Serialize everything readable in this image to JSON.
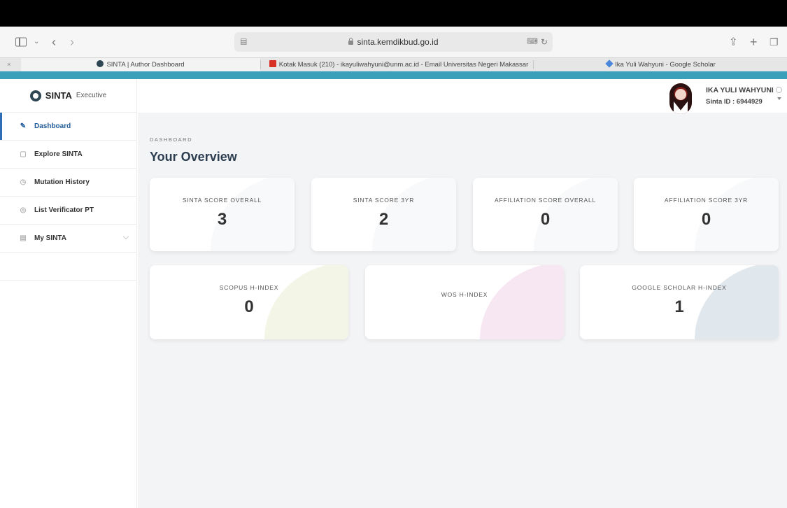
{
  "browser": {
    "url": "sinta.kemdikbud.go.id",
    "tabs": [
      {
        "label": "SINTA | Author Dashboard",
        "active": true
      },
      {
        "label": "Kotak Masuk (210) - ikayuliwahyuni@unm.ac.id - Email Universitas Negeri Makassar",
        "active": false
      },
      {
        "label": "Ika Yuli Wahyuni - Google Scholar",
        "active": false
      }
    ]
  },
  "app": {
    "brand": {
      "strong": "SINTA",
      "light": "Executive"
    }
  },
  "sidebar": {
    "items": [
      {
        "label": "Dashboard",
        "icon": "pencil-icon",
        "active": true
      },
      {
        "label": "Explore SINTA",
        "icon": "search-doc-icon"
      },
      {
        "label": "Mutation History",
        "icon": "history-icon"
      },
      {
        "label": "List Verificator PT",
        "icon": "user-circle-icon"
      },
      {
        "label": "My SINTA",
        "icon": "card-icon",
        "expandable": true
      }
    ]
  },
  "user": {
    "name": "IKA YULI WAHYUNI",
    "sinta_id": "Sinta ID : 6944929"
  },
  "main": {
    "breadcrumb": "DASHBOARD",
    "title": "Your Overview",
    "cards_row1": [
      {
        "label": "SINTA SCORE OVERALL",
        "value": "3"
      },
      {
        "label": "SINTA SCORE 3YR",
        "value": "2"
      },
      {
        "label": "AFFILIATION SCORE OVERALL",
        "value": "0"
      },
      {
        "label": "AFFILIATION SCORE 3YR",
        "value": "0"
      }
    ],
    "cards_row2": [
      {
        "label": "SCOPUS H-INDEX",
        "value": "0",
        "accent": "#e9edd2"
      },
      {
        "label": "WOS H-INDEX",
        "value": "",
        "accent": "#f1d3ea"
      },
      {
        "label": "GOOGLE SCHOLAR H-INDEX",
        "value": "1",
        "accent": "#c9d6df"
      }
    ]
  },
  "colors": {
    "teal_bar": "#3a9fb8",
    "active_nav": "#2f6db4"
  }
}
